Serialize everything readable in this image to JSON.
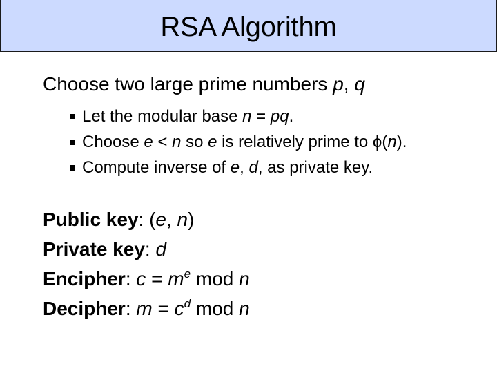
{
  "slide": {
    "title": "RSA Algorithm",
    "heading": {
      "text": "Choose two large prime numbers ",
      "var_p": "p",
      "sep": ", ",
      "var_q": "q"
    },
    "bullets": [
      {
        "parts": [
          "Let the modular base ",
          "n",
          " = ",
          "pq",
          "."
        ]
      },
      {
        "parts": [
          "Choose ",
          "e",
          " < ",
          "n",
          " so ",
          "e",
          " is relatively prime to ϕ(",
          "n",
          ")."
        ]
      },
      {
        "parts": [
          "Compute inverse of ",
          "e",
          ", ",
          "d",
          ", as private key."
        ]
      }
    ],
    "keys": {
      "public": {
        "label": "Public key",
        "colon": ": ",
        "open": "(",
        "e": "e",
        "sep": ", ",
        "n": "n",
        "close": ")"
      },
      "private": {
        "label": "Private key",
        "colon": ": ",
        "d": "d"
      },
      "encipher": {
        "label": "Encipher",
        "colon": ": ",
        "lhs": "c",
        "eq": " = ",
        "base": "m",
        "exp": "e",
        "mod": " mod ",
        "n": "n"
      },
      "decipher": {
        "label": "Decipher",
        "colon": ": ",
        "lhs": "m",
        "eq": " = ",
        "base": "c",
        "exp": "d",
        "mod": " mod ",
        "n": "n"
      }
    }
  }
}
